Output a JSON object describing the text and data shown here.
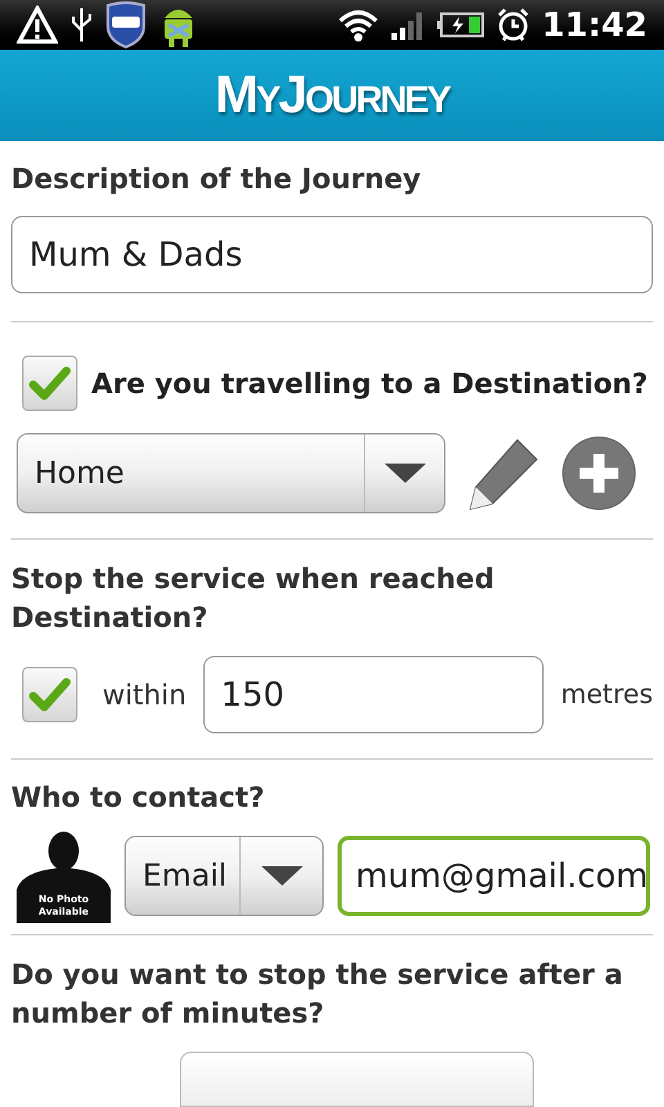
{
  "status_bar": {
    "time": "11:42"
  },
  "header": {
    "title": "MyJourney"
  },
  "description": {
    "label": "Description of the Journey",
    "value": "Mum & Dads"
  },
  "destination": {
    "label": "Are you travelling to a Destination?",
    "checked": true,
    "selection": "Home"
  },
  "stop_on_arrival": {
    "label": "Stop the service when reached Destination?",
    "checked": true,
    "within_label": "within",
    "distance": "150",
    "unit": "metres"
  },
  "contact": {
    "label": "Who to contact?",
    "avatar_caption": [
      "No Photo",
      "Available"
    ],
    "method": "Email",
    "address": "mum@gmail.com",
    "focused": true
  },
  "stop_after_minutes": {
    "label": "Do you want to stop the service after a number of minutes?"
  }
}
